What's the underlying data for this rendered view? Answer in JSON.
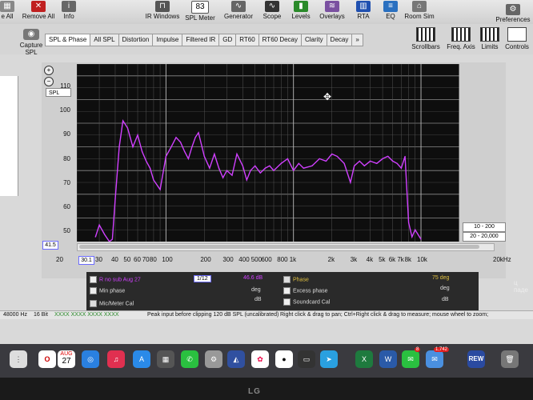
{
  "toolbar": {
    "left_items": [
      "e All",
      "Remove All",
      "Info"
    ],
    "items": [
      "IR Windows",
      "SPL Meter",
      "Generator",
      "Scope",
      "Levels",
      "Overlays",
      "RTA",
      "EQ",
      "Room Sim"
    ],
    "spl_meter_value": "83",
    "preferences": "Preferences"
  },
  "capture": {
    "label": "Capture",
    "spl_label": "SPL"
  },
  "tabs": [
    "SPL & Phase",
    "All SPL",
    "Distortion",
    "Impulse",
    "Filtered IR",
    "GD",
    "RT60",
    "RT60 Decay",
    "Clarity",
    "Decay",
    "»"
  ],
  "right_tools": [
    "Scrollbars",
    "Freq. Axis",
    "Limits",
    "Controls"
  ],
  "plot": {
    "unit_select": "SPL",
    "y_ticks": [
      "110",
      "100",
      "90",
      "80",
      "70",
      "60",
      "50"
    ],
    "x_ticks": [
      "20",
      "30",
      "40",
      "50",
      "60",
      "70",
      "80",
      "100",
      "200",
      "300",
      "400",
      "500",
      "600",
      "800",
      "1k",
      "2k",
      "3k",
      "4k",
      "5k",
      "6k",
      "7k",
      "8k",
      "10k",
      "20kHz"
    ],
    "y_marker": "41.5",
    "x_marker": "30.1",
    "range_top": "10 - 200",
    "range_bottom": "20 - 20,000",
    "zoom_in": "+",
    "zoom_out": "−",
    "trace_color": "#d040ff"
  },
  "chart_data": {
    "type": "line",
    "xscale": "log",
    "xlim": [
      20,
      20000
    ],
    "ylim": [
      40,
      115
    ],
    "series": [
      {
        "name": "R no sub Aug 27",
        "color": "#d040ff",
        "x": [
          28,
          30,
          33,
          36,
          38,
          40,
          43,
          46,
          50,
          55,
          60,
          65,
          70,
          75,
          80,
          90,
          100,
          110,
          120,
          130,
          140,
          150,
          160,
          170,
          180,
          200,
          220,
          240,
          260,
          280,
          300,
          330,
          360,
          400,
          430,
          460,
          500,
          550,
          600,
          650,
          700,
          800,
          900,
          1000,
          1100,
          1200,
          1400,
          1600,
          1800,
          2000,
          2200,
          2500,
          2800,
          3000,
          3300,
          3600,
          4000,
          4500,
          5000,
          5500,
          6000,
          6500,
          7000,
          7500,
          8000,
          8500,
          9000,
          10000
        ],
        "values": [
          42,
          47,
          43,
          40,
          41,
          58,
          80,
          91,
          88,
          80,
          85,
          78,
          74,
          71,
          66,
          62,
          76,
          80,
          84,
          82,
          78,
          75,
          80,
          84,
          86,
          76,
          71,
          77,
          71,
          67,
          70,
          68,
          77,
          72,
          66,
          70,
          72,
          69,
          71,
          72,
          70,
          73,
          75,
          70,
          73,
          71,
          72,
          75,
          74,
          77,
          76,
          73,
          65,
          72,
          74,
          72,
          74,
          73,
          75,
          76,
          74,
          73,
          71,
          76,
          48,
          42,
          45,
          41
        ]
      }
    ]
  },
  "legend": {
    "measurement": "R no sub Aug 27",
    "smoothing": "1/12",
    "spl_value": "46.6 dB",
    "min_phase": "Min phase",
    "deg": "deg",
    "db": "dB",
    "mic_cal": "Mic/Meter Cal",
    "phase": "Phase",
    "phase_value": "75 deg",
    "excess_phase": "Excess phase",
    "deg2": "deg",
    "soundcard_cal": "Soundcard Cal",
    "db2": "dB"
  },
  "status": {
    "rate": "48000 Hz",
    "bits": "16 Bit",
    "levels": "XXXX XXXX  XXXX XXXX",
    "peak": "Peak input before clipping 120 dB SPL (uncalibrated)",
    "hint": "Right click & drag to pan; Ctrl+Right click & drag to measure; mouse wheel to zoom;"
  },
  "side_text": "ц паде",
  "dock": {
    "calendar_month": "AUG",
    "calendar_day": "27",
    "messages_badge": "8",
    "mail_badge": "1,742",
    "rew_label": "REW"
  },
  "monitor_brand": "LG"
}
